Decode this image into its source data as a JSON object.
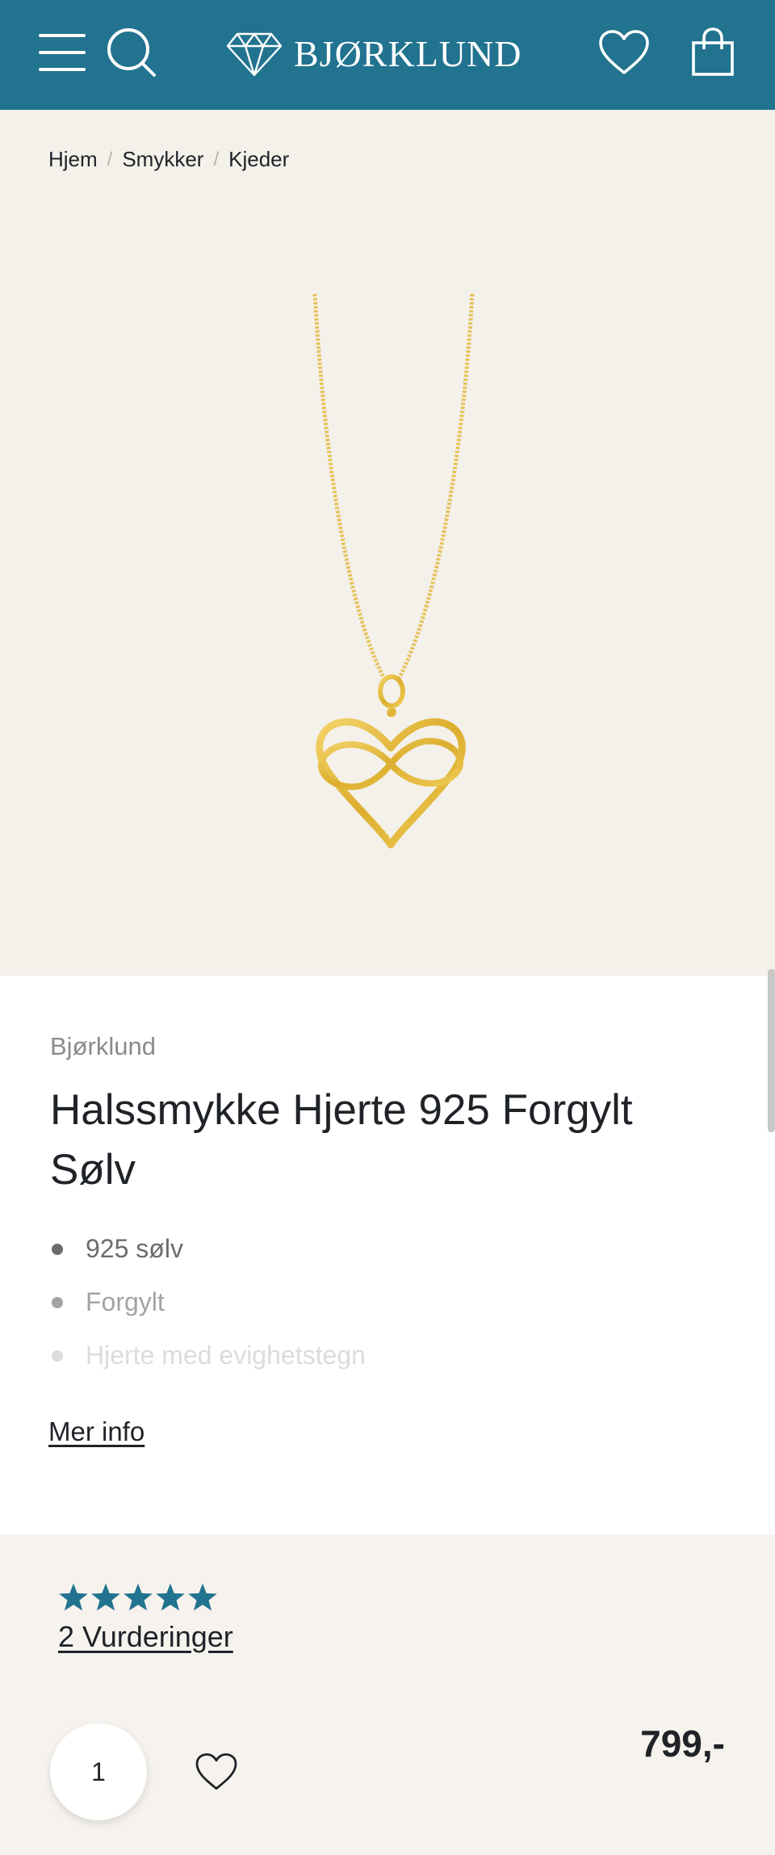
{
  "header": {
    "logo_text": "BJØRKLUND",
    "icons": {
      "menu": "hamburger-icon",
      "search": "search-icon",
      "logo": "diamond-icon",
      "wishlist": "heart-icon",
      "cart": "shopping-bag-icon"
    }
  },
  "breadcrumb": [
    "Hjem",
    "Smykker",
    "Kjeder"
  ],
  "product": {
    "brand": "Bjørklund",
    "title": "Halssmykke Hjerte 925 Forgylt Sølv",
    "features": [
      "925 sølv",
      "Forgylt",
      "Hjerte med evighetstegn"
    ],
    "more_info": "Mer info",
    "rating": {
      "stars": 5,
      "reviews_label": "2 Vurderinger"
    },
    "quantity": "1",
    "price": "799,-"
  },
  "colors": {
    "brand": "#21738f",
    "star": "#21738f",
    "gold": "#e0b63a"
  }
}
